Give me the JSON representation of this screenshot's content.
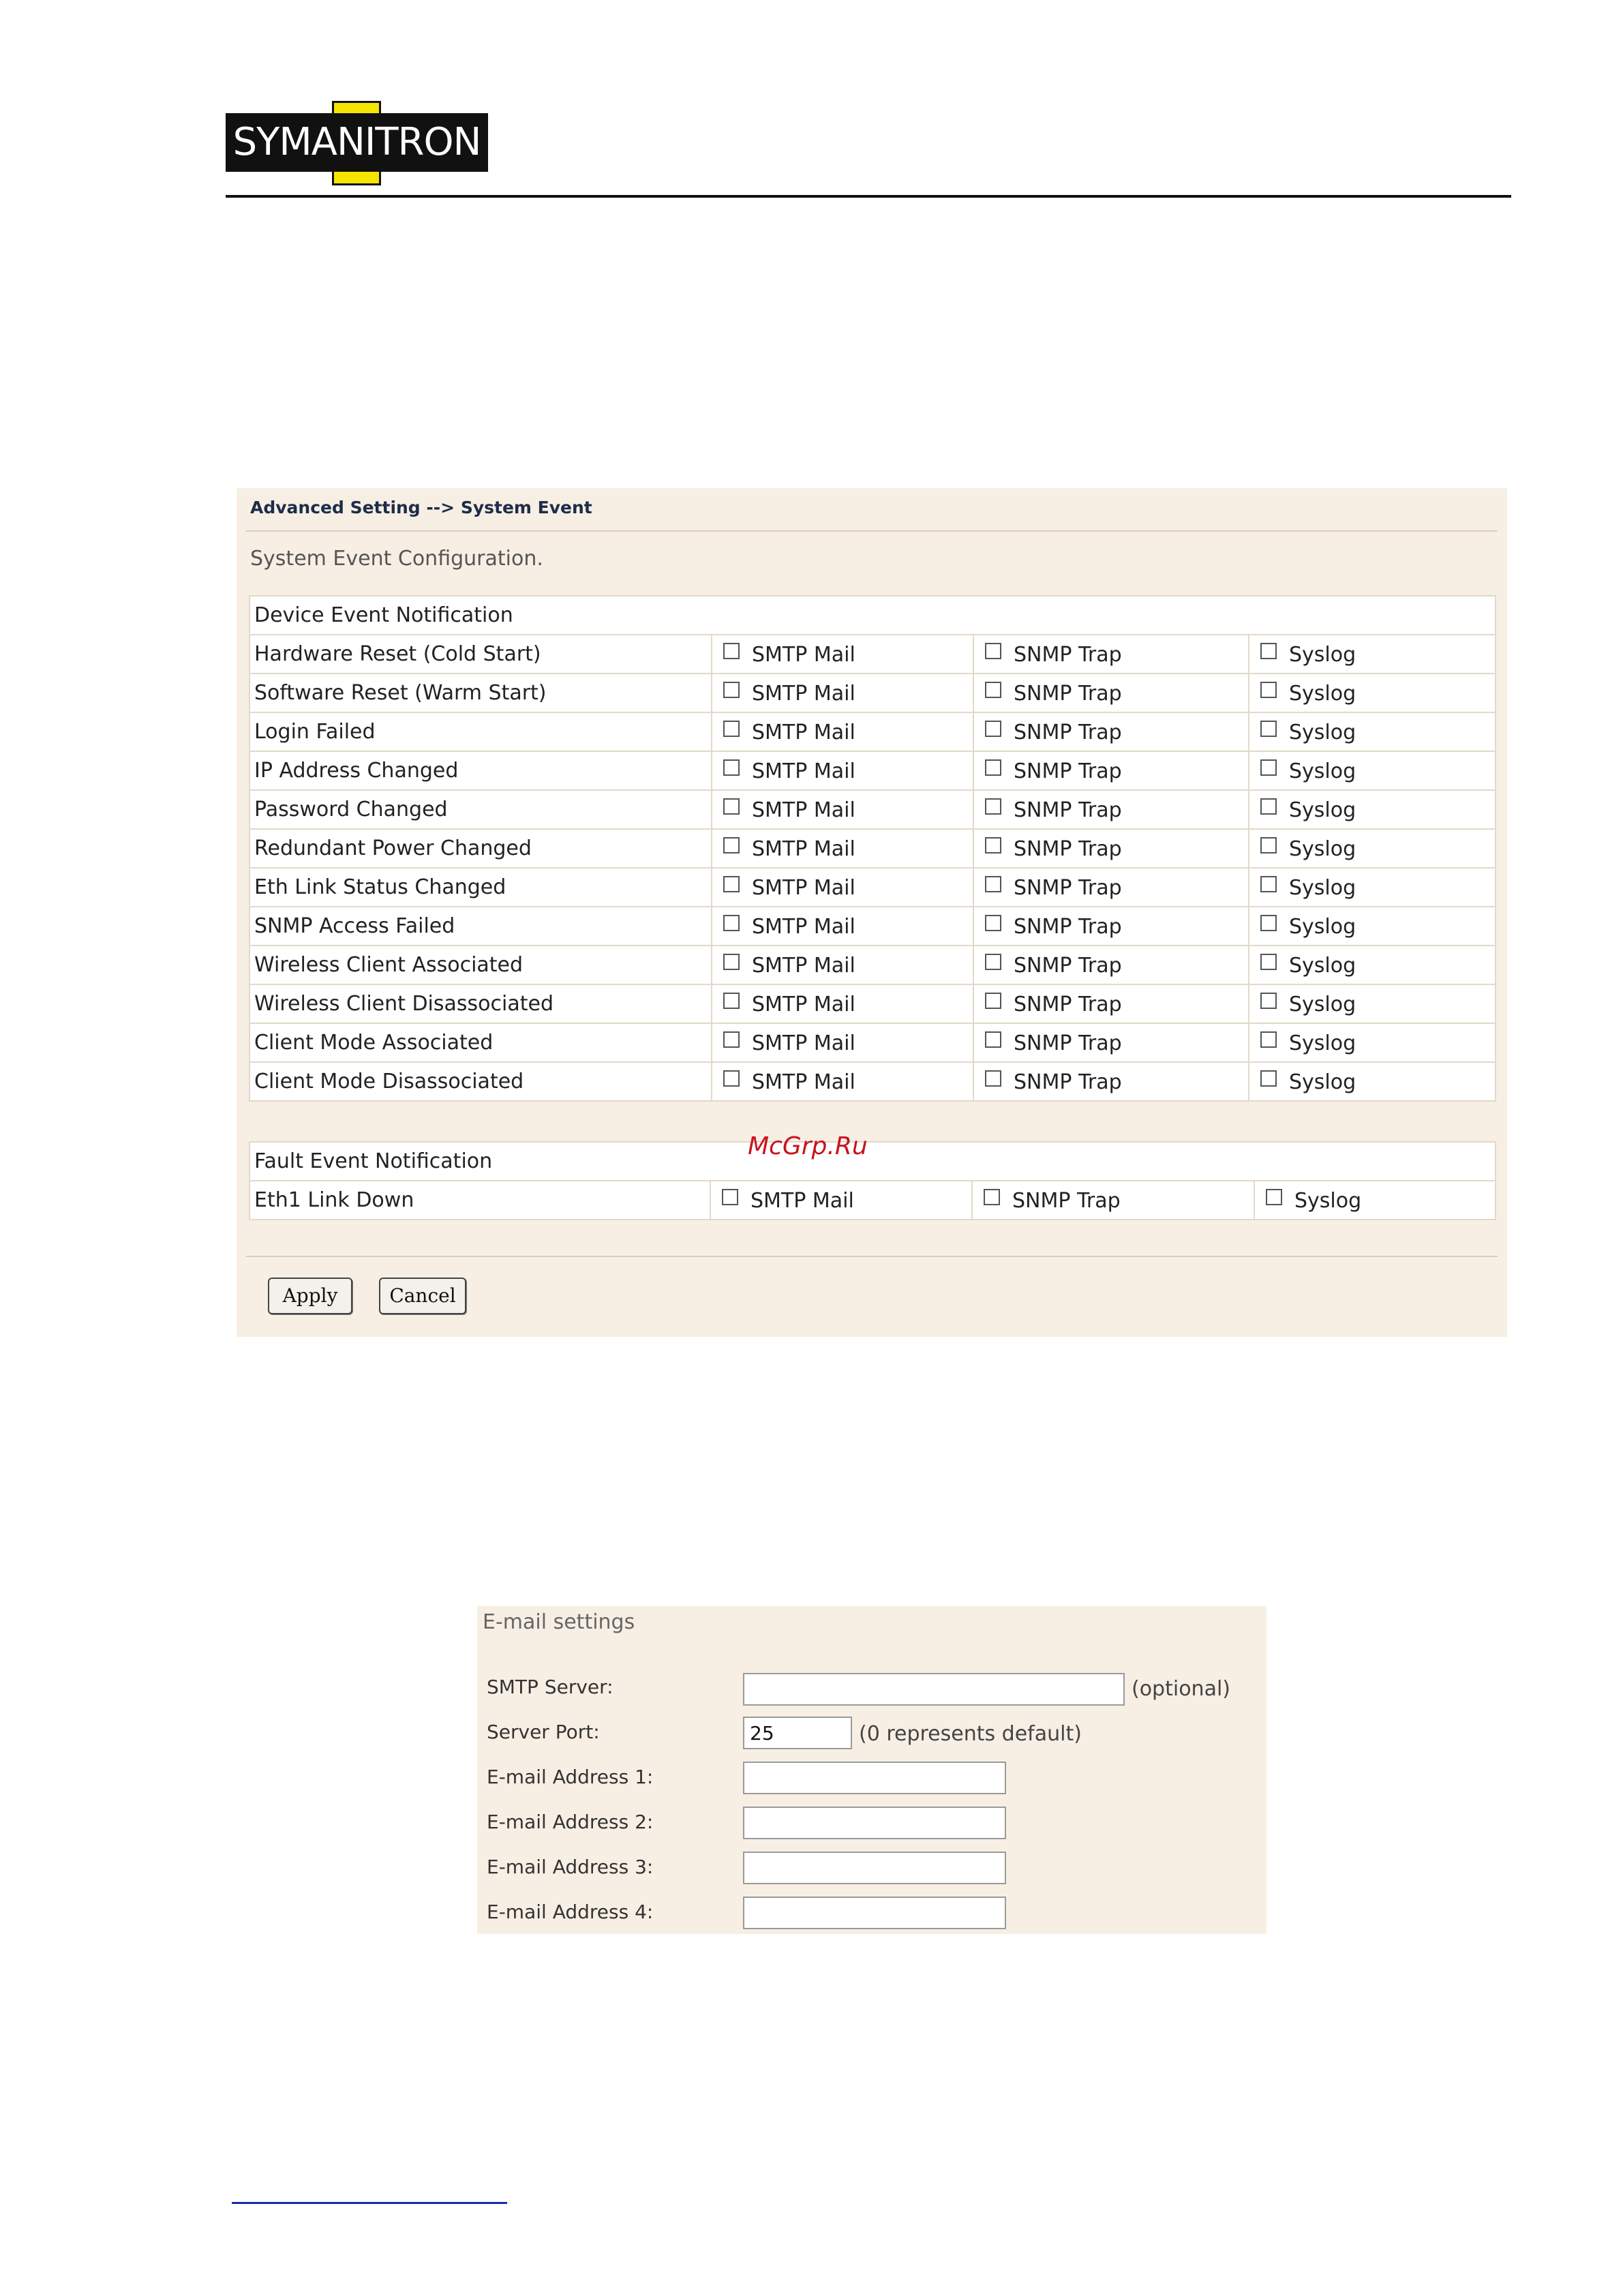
{
  "header": {
    "logo_text": "SYMANITRON"
  },
  "panel": {
    "breadcrumb": "Advanced Setting --> System Event",
    "section_title": "System Event Configuration.",
    "device_header": "Device Event Notification",
    "option_labels": {
      "smtp": "SMTP Mail",
      "snmp": "SNMP Trap",
      "syslog": "Syslog"
    },
    "device_events": [
      "Hardware Reset (Cold Start)",
      "Software Reset (Warm Start)",
      "Login Failed",
      "IP Address Changed",
      "Password Changed",
      "Redundant Power Changed",
      "Eth Link Status Changed",
      "SNMP Access Failed",
      "Wireless Client Associated",
      "Wireless Client Disassociated",
      "Client Mode Associated",
      "Client Mode Disassociated"
    ],
    "fault_header": "Fault Event Notification",
    "fault_events": [
      "Eth1 Link Down"
    ],
    "apply_label": "Apply",
    "cancel_label": "Cancel"
  },
  "watermark": "McGrp.Ru",
  "email_settings": {
    "title": "E-mail settings",
    "smtp_server_label": "SMTP Server:",
    "smtp_server_value": "",
    "smtp_server_note": "(optional)",
    "server_port_label": "Server Port:",
    "server_port_value": "25",
    "server_port_note": "(0 represents default)",
    "address_labels": [
      "E-mail Address 1:",
      "E-mail Address 2:",
      "E-mail Address 3:",
      "E-mail Address 4:"
    ]
  }
}
